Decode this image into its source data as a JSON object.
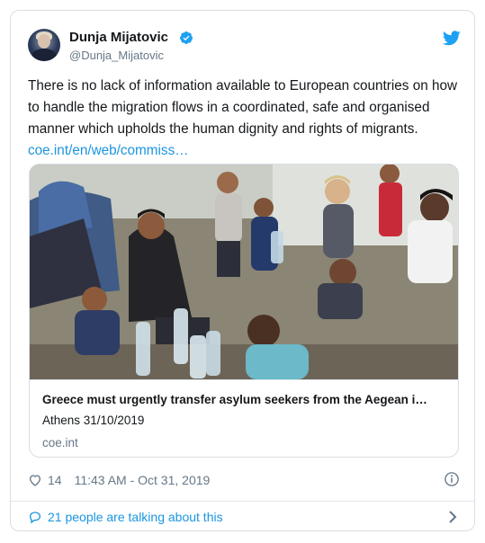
{
  "author": {
    "name": "Dunja Mijatovic",
    "handle": "@Dunja_Mijatovic",
    "avatar_icon": "profile-photo",
    "verified_icon": "verified-badge-icon"
  },
  "tweet": {
    "text": "There is no lack of information available to European countries on how to handle the migration flows in a coordinated, safe and organised manner which upholds the human dignity and rights of migrants.",
    "link_text": "coe.int/en/web/commiss…"
  },
  "link_card": {
    "title": "Greece must urgently transfer asylum seekers from the Aegean i…",
    "subtitle": "Athens 31/10/2019",
    "domain": "coe.int",
    "image_icon": "children-drinking-water-photo"
  },
  "stats": {
    "likes": "14",
    "timestamp": "11:43 AM - Oct 31, 2019"
  },
  "footer": {
    "talking_text": "21 people are talking about this"
  },
  "colors": {
    "accent": "#1b95e0",
    "secondary_text": "#657786",
    "border": "#d9dee3"
  }
}
